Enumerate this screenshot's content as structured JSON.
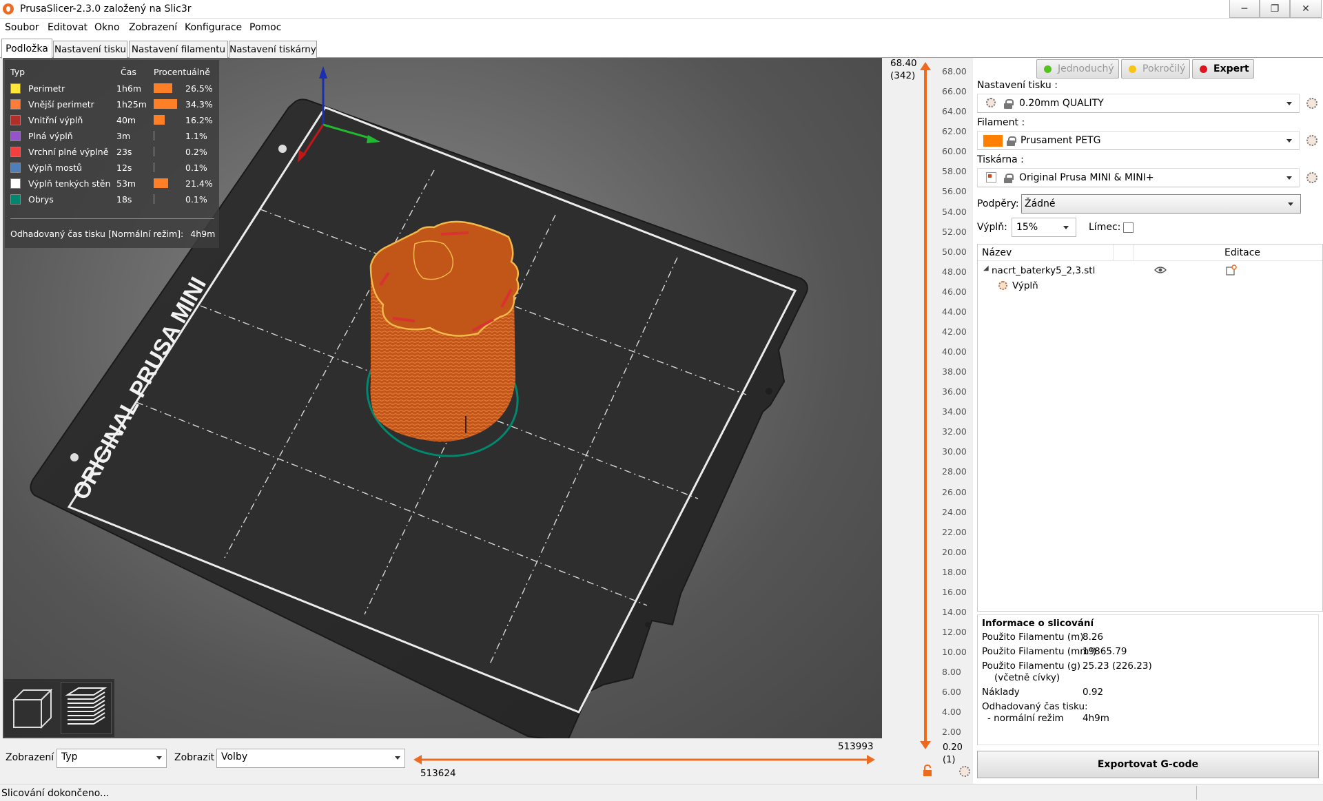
{
  "window": {
    "title": "PrusaSlicer-2.3.0 založený na Slic3r",
    "controls": {
      "minimize": "─",
      "restore": "❐",
      "close": "✕"
    }
  },
  "menu": [
    {
      "label": "Soubor"
    },
    {
      "label": "Editovat"
    },
    {
      "label": "Okno"
    },
    {
      "label": "Zobrazení"
    },
    {
      "label": "Konfigurace"
    },
    {
      "label": "Pomoc"
    }
  ],
  "tabs": [
    {
      "label": "Podložka",
      "active": true
    },
    {
      "label": "Nastavení tisku"
    },
    {
      "label": "Nastavení filamentu"
    },
    {
      "label": "Nastavení tiskárny"
    }
  ],
  "bed": {
    "label": "ORIGINAL PRUSA MINI"
  },
  "legend": {
    "headers": {
      "type": "Typ",
      "time": "Čas",
      "percent": "Procentuálně"
    },
    "rows": [
      {
        "name": "Perimetr",
        "time": "1h6m",
        "percent": "26.5%",
        "fraction": 0.265,
        "color": "#FFE73A"
      },
      {
        "name": "Vnější perimetr",
        "time": "1h25m",
        "percent": "34.3%",
        "fraction": 0.343,
        "color": "#FF7D38"
      },
      {
        "name": "Vnitřní výplň",
        "time": "40m",
        "percent": "16.2%",
        "fraction": 0.162,
        "color": "#B03029"
      },
      {
        "name": "Plná výplň",
        "time": "3m",
        "percent": "1.1%",
        "fraction": 0.011,
        "color": "#9654CC"
      },
      {
        "name": "Vrchní plné výplně",
        "time": "23s",
        "percent": "0.2%",
        "fraction": 0.002,
        "color": "#F04040"
      },
      {
        "name": "Výplň mostů",
        "time": "12s",
        "percent": "0.1%",
        "fraction": 0.001,
        "color": "#4D80BA"
      },
      {
        "name": "Výplň tenkých stěn",
        "time": "53m",
        "percent": "21.4%",
        "fraction": 0.214,
        "color": "#FFFFFF"
      },
      {
        "name": "Obrys",
        "time": "18s",
        "percent": "0.1%",
        "fraction": 0.001,
        "color": "#00876E"
      }
    ],
    "estimate_label": "Odhadovaný čas tisku [Normální režim]:",
    "estimate_value": "4h9m"
  },
  "bottom": {
    "view_label": "Zobrazení",
    "view_value": "Typ",
    "show_label": "Zobrazit",
    "show_value": "Volby",
    "hslider_left": "513624",
    "hslider_right": "513993"
  },
  "vslider": {
    "top_value": "68.40",
    "top_layer": "(342)",
    "bottom_value": "0.20",
    "bottom_layer": "(1)",
    "ticks": [
      "68.00",
      "66.00",
      "64.00",
      "62.00",
      "60.00",
      "58.00",
      "56.00",
      "54.00",
      "52.00",
      "50.00",
      "48.00",
      "46.00",
      "44.00",
      "42.00",
      "40.00",
      "38.00",
      "36.00",
      "34.00",
      "32.00",
      "30.00",
      "28.00",
      "26.00",
      "24.00",
      "22.00",
      "20.00",
      "18.00",
      "16.00",
      "14.00",
      "12.00",
      "10.00",
      "8.00",
      "6.00",
      "4.00",
      "2.00"
    ]
  },
  "sidebar": {
    "modes": [
      {
        "label": "Jednoduchý",
        "color": "#52c41a",
        "active": false
      },
      {
        "label": "Pokročilý",
        "color": "#f5c518",
        "active": false
      },
      {
        "label": "Expert",
        "color": "#e0141e",
        "active": true
      }
    ],
    "print_label": "Nastavení tisku :",
    "print_value": "0.20mm QUALITY",
    "filament_label": "Filament :",
    "filament_value": "Prusament PETG",
    "filament_color": "#FF7F00",
    "printer_label": "Tiskárna :",
    "printer_value": "Original Prusa MINI & MINI+",
    "supports_label": "Podpěry:",
    "supports_value": "Žádné",
    "infill_label": "Výplň:",
    "infill_value": "15%",
    "brim_label": "Límec:",
    "objects": {
      "col_name": "Název",
      "col_edit": "Editace",
      "items": [
        {
          "name": "nacrt_baterky5_2,3.stl"
        },
        {
          "name": "Výplň"
        }
      ]
    },
    "info": {
      "title": "Informace o slicování",
      "rows": [
        {
          "key": "Použito Filamentu (m)",
          "value": "8.26"
        },
        {
          "key": "Použito Filamentu (mm³)",
          "value": "19865.79"
        },
        {
          "key": "Použito Filamentu (g)",
          "key2": "(včetně cívky)",
          "value": "25.23 (226.23)"
        },
        {
          "key": "Náklady",
          "value": "0.92"
        },
        {
          "key": "Odhadovaný čas tisku:",
          "key2": "- normální režim",
          "value": "4h9m"
        }
      ]
    },
    "export_label": "Exportovat G-code"
  },
  "status": {
    "text": "Slicování dokončeno..."
  }
}
